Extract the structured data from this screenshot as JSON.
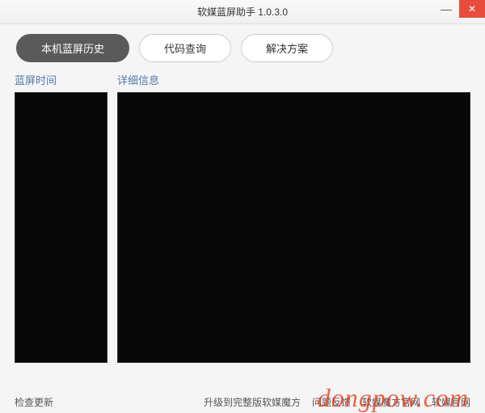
{
  "titlebar": {
    "title": "软媒蓝屏助手 1.0.3.0"
  },
  "tabs": {
    "history": "本机蓝屏历史",
    "lookup": "代码查询",
    "solution": "解决方案"
  },
  "columns": {
    "time": "蓝屏时间",
    "detail": "详细信息"
  },
  "footer": {
    "check_update": "检查更新",
    "upgrade": "升级到完整版软媒魔方",
    "feedback": "问题反馈",
    "mofang_site": "软媒魔方官网",
    "ruanmei_site": "软媒官网"
  },
  "watermark": "dongpow.com"
}
